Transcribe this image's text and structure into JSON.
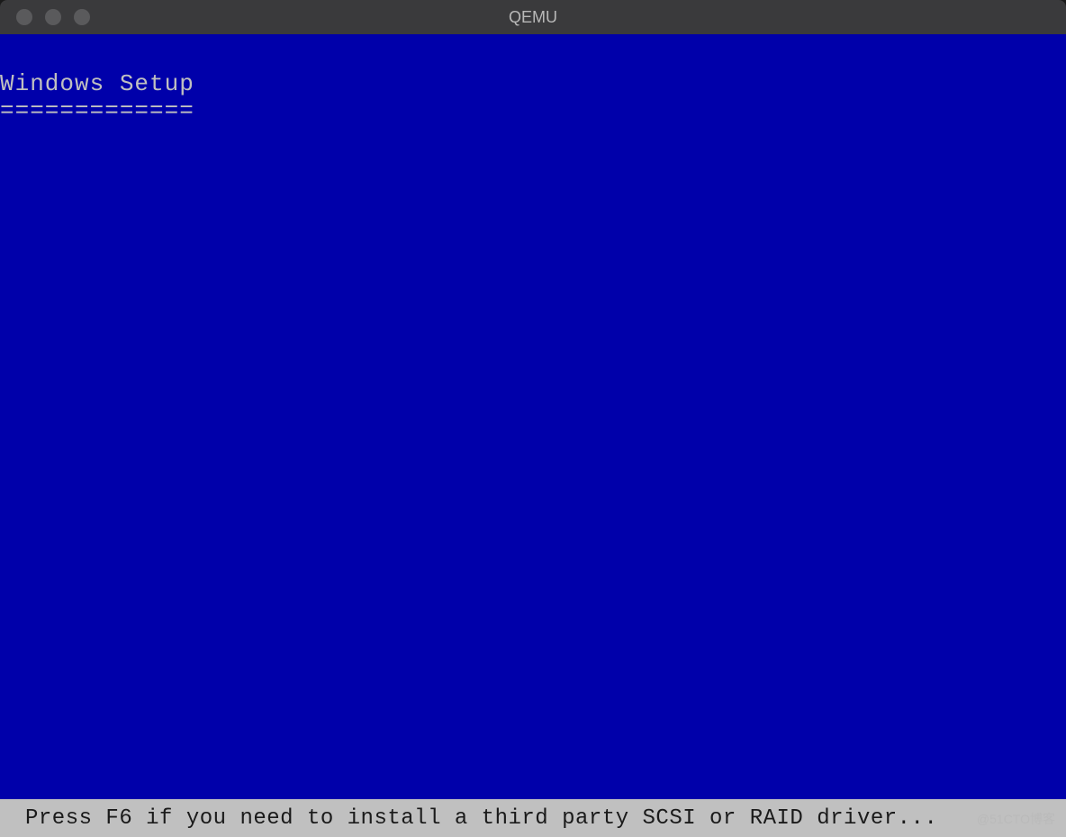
{
  "window": {
    "title": "QEMU"
  },
  "setup": {
    "heading": "Windows Setup",
    "underline": "============="
  },
  "statusbar": {
    "message": "Press F6 if you need to install a third party SCSI or RAID driver..."
  },
  "watermark": "@51CTO博客"
}
